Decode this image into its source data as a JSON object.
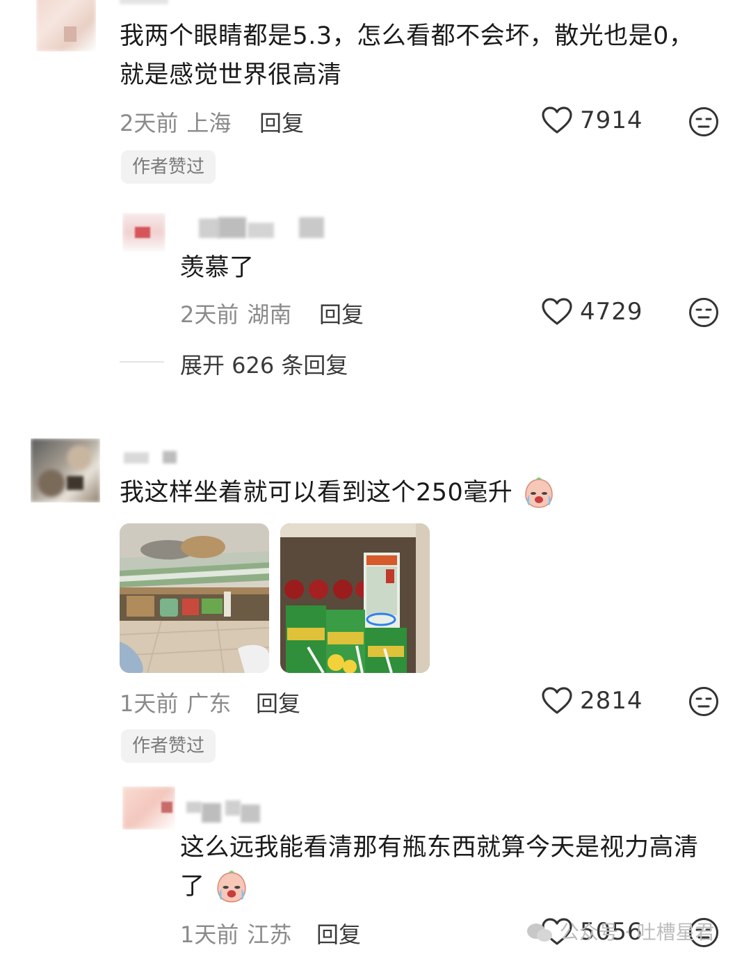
{
  "comments": [
    {
      "text": "我两个眼睛都是5.3，怎么看都不会坏，散光也是0，就是感觉世界很高清",
      "time": "2天前",
      "location": "上海",
      "reply_label": "回复",
      "likes": "7914",
      "badge": "作者赞过",
      "replies": [
        {
          "text": "羡慕了",
          "time": "2天前",
          "location": "湖南",
          "reply_label": "回复",
          "likes": "4729"
        }
      ],
      "expand_label": "展开 626 条回复"
    },
    {
      "text": "我这样坐着就可以看到这个250毫升",
      "time": "1天前",
      "location": "广东",
      "reply_label": "回复",
      "likes": "2814",
      "badge": "作者赞过",
      "replies": [
        {
          "text": "这么远我能看清那有瓶东西就算今天是视力高清了",
          "time": "1天前",
          "location": "江苏",
          "reply_label": "回复",
          "likes": "5056"
        }
      ]
    }
  ],
  "watermark": "公众号 · 吐槽星君",
  "colors": {
    "icon": "#333333",
    "meta": "#8a8a8a",
    "badge_bg": "#f2f2f2"
  }
}
